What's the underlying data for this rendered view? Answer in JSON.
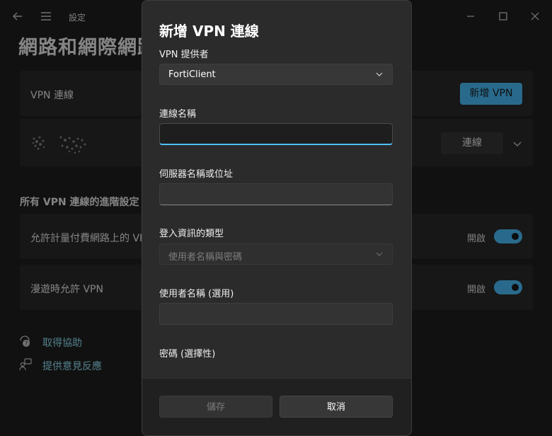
{
  "window": {
    "title": "設定",
    "page_title": "網路和網際網路"
  },
  "cards": {
    "vpn_connections_label": "VPN 連線",
    "add_vpn_button": "新增 VPN",
    "connect_button": "連線",
    "advanced_title": "所有 VPN 連線的進階設定",
    "metered_label": "允許計量付費網路上的 VPN",
    "metered_state": "開啟",
    "roaming_label": "漫遊時允許 VPN",
    "roaming_state": "開啟"
  },
  "links": {
    "get_help": "取得協助",
    "feedback": "提供意見反應"
  },
  "dialog": {
    "title": "新增 VPN 連線",
    "provider_label": "VPN 提供者",
    "provider_value": "FortiClient",
    "connection_name_label": "連線名稱",
    "connection_name_value": "",
    "server_label": "伺服器名稱或位址",
    "server_value": "",
    "signin_type_label": "登入資訊的類型",
    "signin_type_value": "使用者名稱與密碼",
    "username_label": "使用者名稱 (選用)",
    "username_value": "",
    "password_label": "密碼 (選擇性)",
    "save_button": "儲存",
    "cancel_button": "取消"
  },
  "colors": {
    "accent": "#4cc2ff",
    "background": "#1f1f1f",
    "card": "#2b2b2b"
  }
}
